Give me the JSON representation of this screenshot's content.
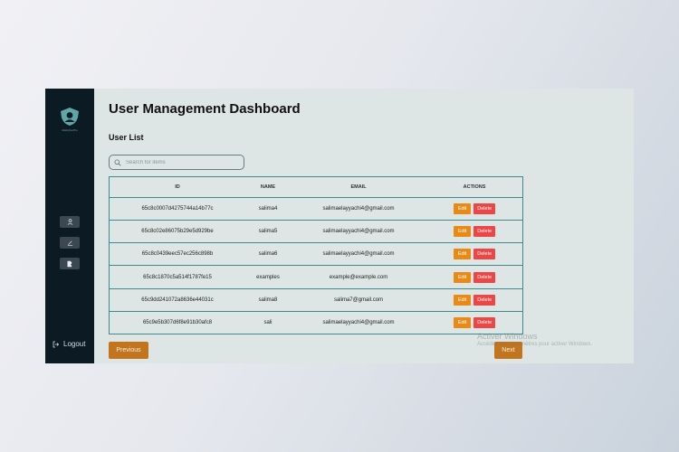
{
  "sidebar": {
    "brand": "Ai&CyberPro",
    "logout_label": "Logout"
  },
  "main": {
    "title": "User Management Dashboard",
    "subtitle": "User List"
  },
  "search": {
    "placeholder": "Search for items"
  },
  "table": {
    "columns": [
      "ID",
      "NAME",
      "EMAIL",
      "ACTIONS"
    ],
    "rows": [
      {
        "id": "65c8c0007d4275744a14b77c",
        "name": "salima4",
        "email": "salimaelayyachi4@gmail.com"
      },
      {
        "id": "65c8c02e86075b29e5d929be",
        "name": "salima5",
        "email": "salimaelayyachi4@gmail.com"
      },
      {
        "id": "65c8c0439eec57ec256c898b",
        "name": "salima6",
        "email": "salimaelayyachi4@gmail.com"
      },
      {
        "id": "65c8c1870c5a514f1787fe15",
        "name": "examples",
        "email": "example@example.com"
      },
      {
        "id": "65c9dd241072a8636e44031c",
        "name": "salima8",
        "email": "salima7@gmail.com"
      },
      {
        "id": "65c9e5b307d6f8e91b30afc8",
        "name": "sali",
        "email": "salimaelayyachi4@gmail.com"
      }
    ],
    "edit_label": "Edit",
    "delete_label": "Delete"
  },
  "pagination": {
    "previous_label": "Previous",
    "next_label": "Next"
  },
  "watermark": {
    "line1": "Activer Windows",
    "line2": "Accédez aux paramètres pour activer Windows."
  },
  "icons": {
    "logo": "shield-logo-icon",
    "users": "user-icon",
    "edit": "pencil-icon",
    "add": "add-file-icon",
    "logout": "logout-icon",
    "search": "search-icon"
  },
  "colors": {
    "sidebar_bg": "#0c1a24",
    "main_bg": "#dde6e4",
    "edit_btn": "#e98a17",
    "delete_btn": "#ec4646",
    "pager_btn": "#c2751c",
    "table_border": "#3f8a8e"
  }
}
